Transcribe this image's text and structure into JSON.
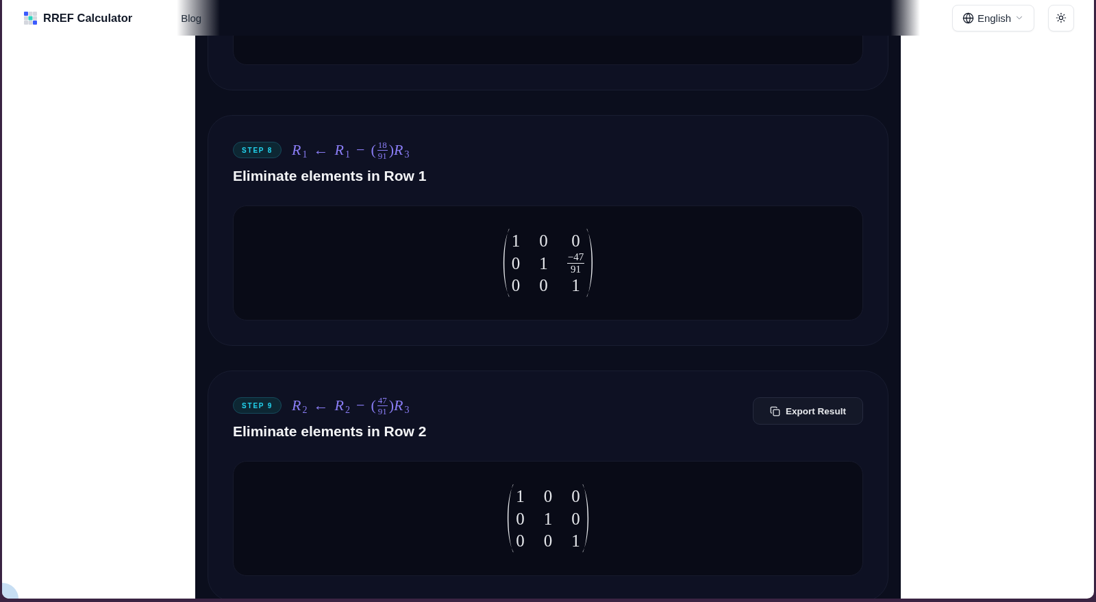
{
  "header": {
    "logo_text": "RREF Calculator",
    "nav": [
      {
        "label": "Blog"
      }
    ],
    "language_button": {
      "label": "English"
    }
  },
  "steps": [
    {
      "kind": "cut_off"
    },
    {
      "kind": "full",
      "badge": "STEP 8",
      "operation": [
        {
          "kind": "var",
          "name": "R",
          "sub": "1"
        },
        {
          "kind": "op",
          "text": "←"
        },
        {
          "kind": "var",
          "name": "R",
          "sub": "1"
        },
        {
          "kind": "op",
          "text": "−"
        },
        {
          "kind": "paren",
          "text": "("
        },
        {
          "kind": "frac",
          "num": "18",
          "den": "91"
        },
        {
          "kind": "paren",
          "text": ")"
        },
        {
          "kind": "var",
          "name": "R",
          "sub": "3"
        }
      ],
      "title": "Eliminate elements in Row 1",
      "matrix": [
        [
          {
            "kind": "num",
            "text": "1"
          },
          {
            "kind": "num",
            "text": "0"
          },
          {
            "kind": "num",
            "text": "0"
          }
        ],
        [
          {
            "kind": "num",
            "text": "0"
          },
          {
            "kind": "num",
            "text": "1"
          },
          {
            "kind": "frac",
            "num": "−47",
            "den": "91"
          }
        ],
        [
          {
            "kind": "num",
            "text": "0"
          },
          {
            "kind": "num",
            "text": "0"
          },
          {
            "kind": "num",
            "text": "1"
          }
        ]
      ]
    },
    {
      "kind": "full",
      "badge": "STEP 9",
      "operation": [
        {
          "kind": "var",
          "name": "R",
          "sub": "2"
        },
        {
          "kind": "op",
          "text": "←"
        },
        {
          "kind": "var",
          "name": "R",
          "sub": "2"
        },
        {
          "kind": "op",
          "text": "−"
        },
        {
          "kind": "paren",
          "text": "("
        },
        {
          "kind": "frac",
          "num": "47",
          "den": "91"
        },
        {
          "kind": "paren",
          "text": ")"
        },
        {
          "kind": "var",
          "name": "R",
          "sub": "3"
        }
      ],
      "title": "Eliminate elements in Row 2",
      "export_button": {
        "label": "Export Result"
      },
      "matrix": [
        [
          {
            "kind": "num",
            "text": "1"
          },
          {
            "kind": "num",
            "text": "0"
          },
          {
            "kind": "num",
            "text": "0"
          }
        ],
        [
          {
            "kind": "num",
            "text": "0"
          },
          {
            "kind": "num",
            "text": "1"
          },
          {
            "kind": "num",
            "text": "0"
          }
        ],
        [
          {
            "kind": "num",
            "text": "0"
          },
          {
            "kind": "num",
            "text": "0"
          },
          {
            "kind": "num",
            "text": "1"
          }
        ]
      ]
    }
  ]
}
